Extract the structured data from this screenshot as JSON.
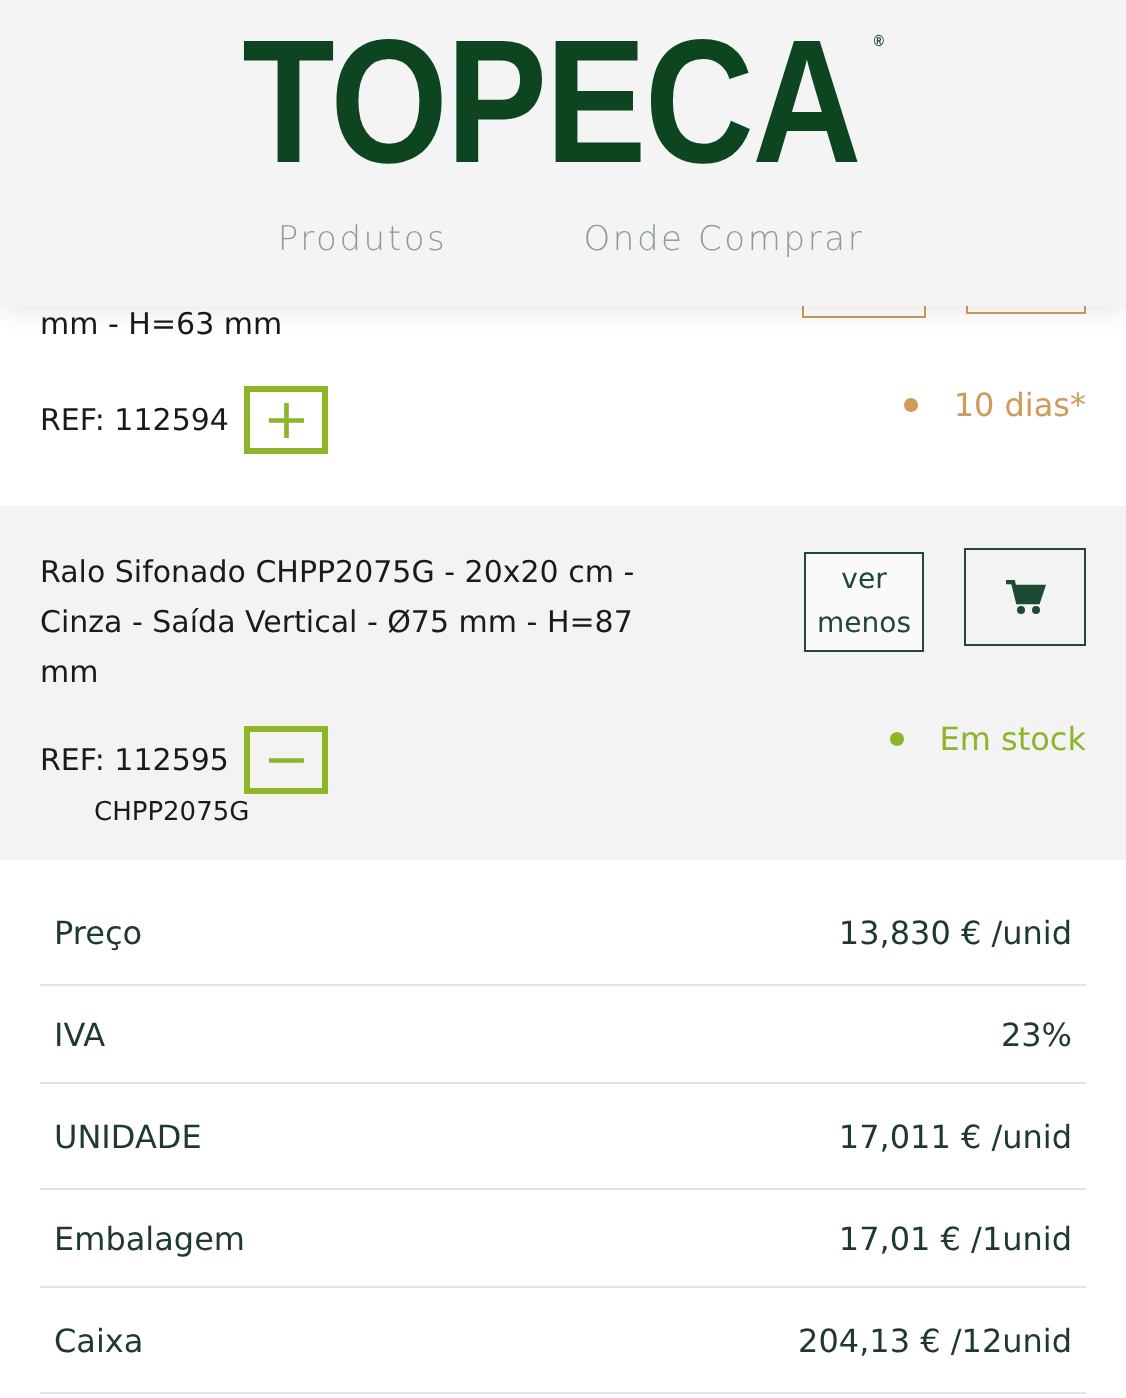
{
  "header": {
    "logo": "TOPECA$^{®}$",
    "nav": [
      "Produtos",
      "Onde Comprar"
    ]
  },
  "products": [
    {
      "title": "mm - H=63 mm",
      "ref": "REF: 112594",
      "toggle": "+",
      "expanded": false,
      "kind": "partial",
      "status": "10 dias*",
      "color": "#cf9a5c"
    },
    {
      "title": "Ralo Sifonado CHPP2075G - 20x20 cm - Cinza - Saída Vertical - Ø75 mm - H=87 mm",
      "ref": "REF: 112595",
      "toggle": "−",
      "expanded": true,
      "kind": "full",
      "code": "CHPP2075G",
      "status": "Em stock",
      "color": "#8db52a",
      "more_button": "ver menos"
    }
  ],
  "details": [
    {
      "label": "Preço",
      "value": "13,830 € /unid"
    },
    {
      "label": "IVA",
      "value": "23%"
    },
    {
      "label": "UNIDADE",
      "value": "17,011 € /unid"
    },
    {
      "label": "Embalagem",
      "value": "17,01 € /1unid"
    },
    {
      "label": "Caixa",
      "value": "204,13 € /12unid"
    }
  ]
}
